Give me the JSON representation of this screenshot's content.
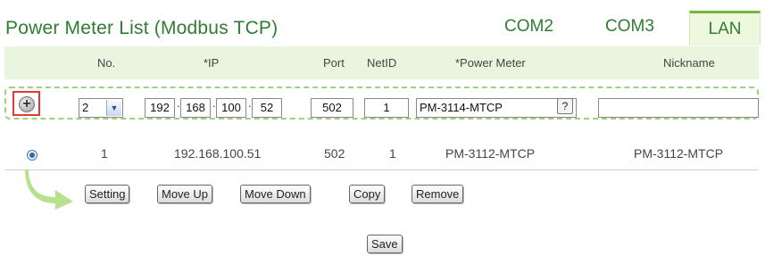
{
  "title": "Power Meter List (Modbus TCP)",
  "tabs": [
    {
      "label": "COM2"
    },
    {
      "label": "COM3"
    },
    {
      "label": "LAN",
      "active": true
    }
  ],
  "columns": [
    "No.",
    "*IP",
    "Port",
    "NetID",
    "*Power Meter",
    "Nickname"
  ],
  "add_row": {
    "number_select": "2",
    "ip": [
      "192",
      "168",
      "100",
      "52"
    ],
    "port": "502",
    "netid": "1",
    "power_meter": "PM-3114-MTCP",
    "help": "?",
    "nickname": ""
  },
  "rows": [
    {
      "no": "1",
      "ip": "192.168.100.51",
      "port": "502",
      "netid": "1",
      "power_meter": "PM-3112-MTCP",
      "nickname": "PM-3112-MTCP"
    }
  ],
  "actions": [
    "Setting",
    "Move Up",
    "Move Down",
    "Copy",
    "Remove"
  ],
  "save_label": "Save",
  "colors": {
    "accent": "#2e7d32",
    "header_bg": "#eaf5df",
    "dashed_border": "#9fd27a",
    "highlight": "#e53935"
  },
  "icons": {
    "add": "plus-circle-icon",
    "arrow": "curved-arrow-icon",
    "radio": "radio-selected-icon"
  }
}
